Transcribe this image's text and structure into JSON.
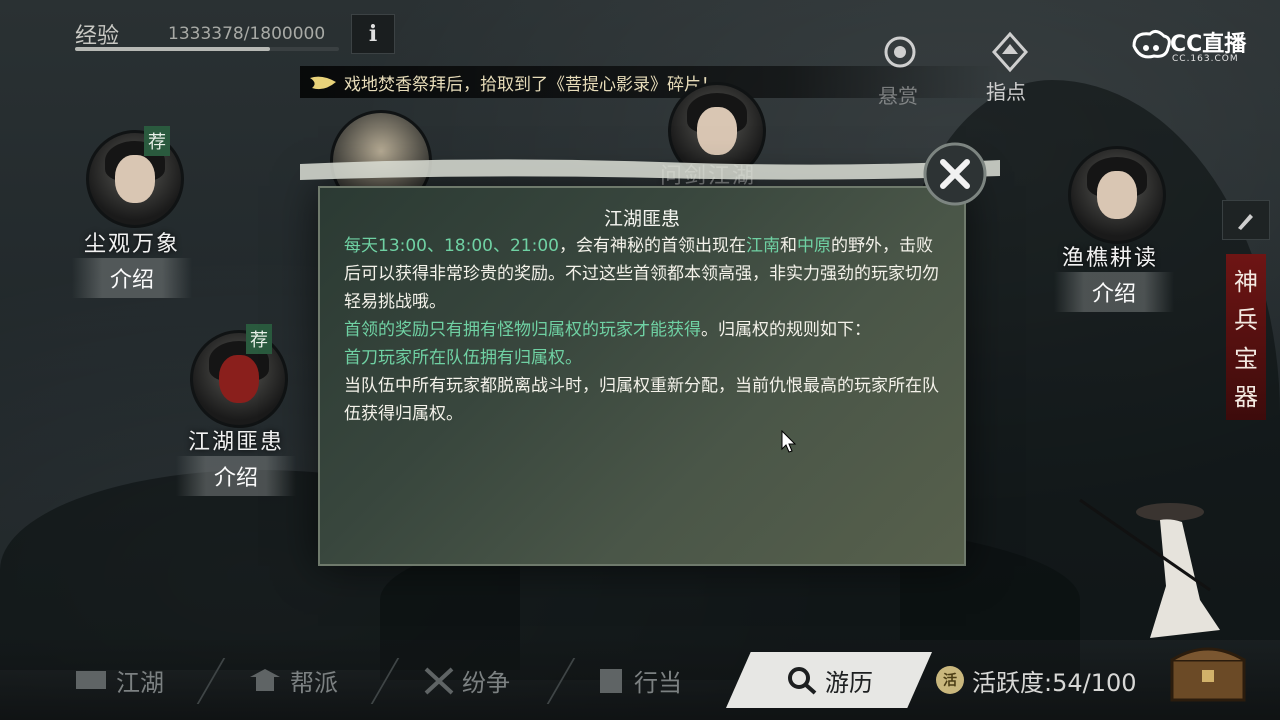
{
  "top_bar": {
    "exp_label": "经验",
    "exp_value": "1333378/1800000",
    "exp_progress": 0.74,
    "info_label": "i",
    "ticker_text": "戏地焚香祭拜后，拾取到了《菩提心影录》碎片！",
    "reward_label": "悬赏",
    "guide_label": "指点"
  },
  "stream": {
    "logo_text": "CC直播",
    "logo_sub": "CC.163.COM"
  },
  "npcs": [
    {
      "name": "尘观万象",
      "intro": "介绍",
      "badge": "荐"
    },
    {
      "name": "江湖匪患",
      "intro": "介绍",
      "badge": "荐"
    },
    {
      "name": "问剑江湖"
    },
    {
      "name": "渔樵耕读",
      "intro": "介绍"
    }
  ],
  "dialog": {
    "title": "江湖匪患",
    "line1_hl": "每天13:00、18:00、21:00",
    "line1_a": "，会有神秘的首领出现在",
    "line1_place1": "江南",
    "line1_b": "和",
    "line1_place2": "中原",
    "line1_c": "的野外，击败后可以获得非常珍贵的奖励。不过这些首领都本领高强，非实力强劲的玩家切勿轻易挑战哦。",
    "line2_hl": "首领的奖励只有拥有怪物归属权的玩家才能获得",
    "line2_rest": "。归属权的规则如下：",
    "line3_hl": "首刀玩家所在队伍拥有归属权。",
    "line4": "当队伍中所有玩家都脱离战斗时，归属权重新分配，当前仇恨最高的玩家所在队伍获得归属权。"
  },
  "side_tab": [
    "神",
    "兵",
    "宝",
    "器"
  ],
  "bottom_nav": {
    "items": [
      "江湖",
      "帮派",
      "纷争",
      "行当",
      "游历"
    ],
    "active_index": 4,
    "activity_badge": "活",
    "activity_label": "活跃度:54/100"
  },
  "colors": {
    "highlight": "#6fd1a3",
    "side_tab": "#6e1514",
    "active_nav": "#e7e7e4"
  }
}
